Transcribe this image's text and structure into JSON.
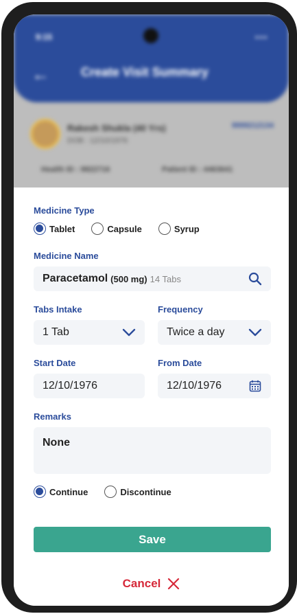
{
  "background_app": {
    "status_time": "9:15",
    "status_icons": "▪▪▪",
    "header_title": "Create Visit Summary",
    "patient_name": "Rakesh Shukla (40 Yrs)",
    "patient_sub": "DOB : 12/10/1976",
    "patient_phone": "9999212134",
    "health_id": "Health ID : 9822716",
    "patient_id": "Patient ID : 4463641"
  },
  "form": {
    "medicine_type_label": "Medicine Type",
    "medicine_type_options": [
      "Tablet",
      "Capsule",
      "Syrup"
    ],
    "medicine_type_selected": "Tablet",
    "medicine_name_label": "Medicine Name",
    "medicine_name": "Paracetamol",
    "medicine_strength": "(500 mg)",
    "medicine_count": "14 Tabs",
    "tabs_intake_label": "Tabs Intake",
    "tabs_intake_value": "1 Tab",
    "frequency_label": "Frequency",
    "frequency_value": "Twice a day",
    "start_date_label": "Start Date",
    "start_date_value": "12/10/1976",
    "from_date_label": "From Date",
    "from_date_value": "12/10/1976",
    "remarks_label": "Remarks",
    "remarks_value": "None",
    "status_options": [
      "Continue",
      "Discontinue"
    ],
    "status_selected": "Continue",
    "save_label": "Save",
    "cancel_label": "Cancel"
  },
  "colors": {
    "primary": "#2b4c9b",
    "save": "#3aa58f",
    "cancel": "#d62839"
  },
  "icons": {
    "search": "search-icon",
    "dropdown": "chevron-down-icon",
    "calendar": "calendar-icon",
    "close": "close-icon",
    "back": "back-arrow-icon"
  }
}
